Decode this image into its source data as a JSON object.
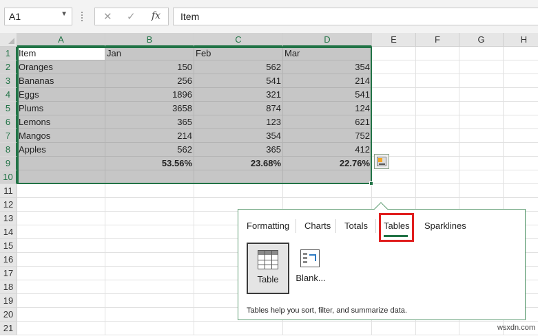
{
  "formula_bar": {
    "name_box": "A1",
    "cancel_glyph": "✕",
    "enter_glyph": "✓",
    "fx_label": "fx",
    "formula_value": "Item"
  },
  "columns": [
    "A",
    "B",
    "C",
    "D",
    "E",
    "F",
    "G",
    "H"
  ],
  "rows": [
    "1",
    "2",
    "3",
    "4",
    "5",
    "6",
    "7",
    "8",
    "9",
    "10",
    "11",
    "12",
    "13",
    "14",
    "15",
    "16",
    "17",
    "18",
    "19",
    "20",
    "21"
  ],
  "cells": {
    "A1": "Item",
    "B1": "Jan",
    "C1": "Feb",
    "D1": "Mar",
    "A2": "Oranges",
    "B2": "150",
    "C2": "562",
    "D2": "354",
    "A3": "Bananas",
    "B3": "256",
    "C3": "541",
    "D3": "214",
    "A4": "Eggs",
    "B4": "1896",
    "C4": "321",
    "D4": "541",
    "A5": "Plums",
    "B5": "3658",
    "C5": "874",
    "D5": "124",
    "A6": "Lemons",
    "B6": "365",
    "C6": "123",
    "D6": "621",
    "A7": "Mangos",
    "B7": "214",
    "C7": "354",
    "D7": "752",
    "A8": "Apples",
    "B8": "562",
    "C8": "365",
    "D8": "412",
    "B9": "53.56%",
    "C9": "23.68%",
    "D9": "22.76%"
  },
  "quick_analysis": {
    "tabs": [
      "Formatting",
      "Charts",
      "Totals",
      "Tables",
      "Sparklines"
    ],
    "active_tab": "Tables",
    "options": [
      "Table",
      "Blank..."
    ],
    "description": "Tables help you sort, filter, and summarize data.",
    "accent_color": "#217346",
    "highlight_color": "#e01e1e"
  },
  "watermark": "wsxdn.com"
}
